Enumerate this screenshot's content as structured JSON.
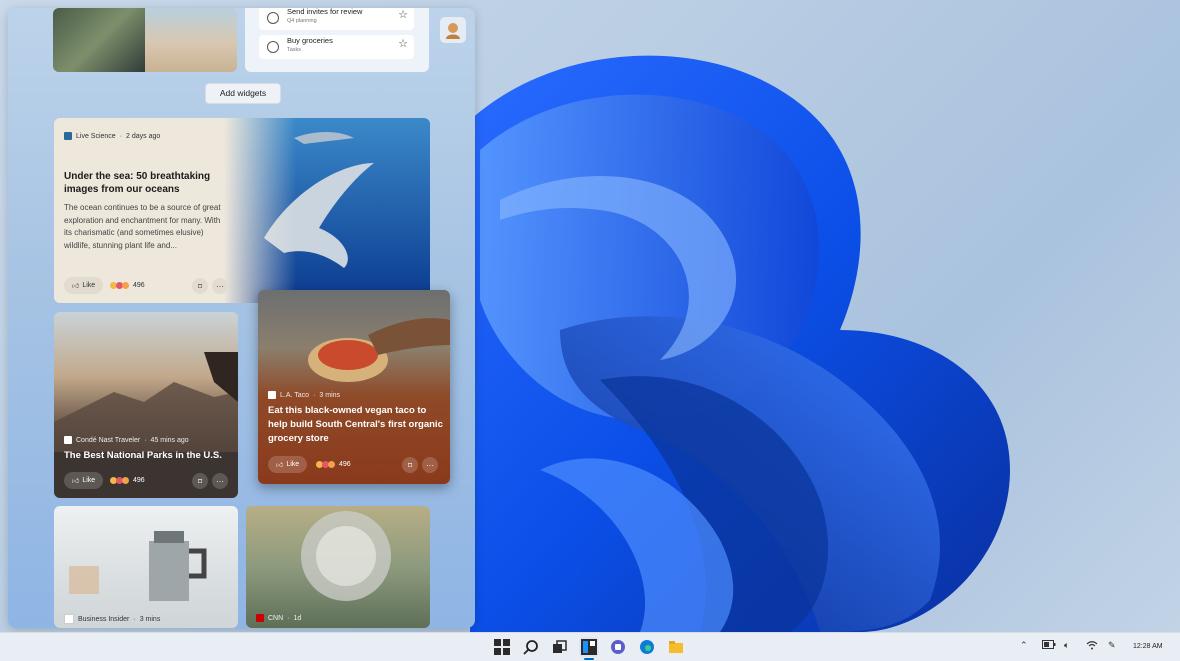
{
  "todo": {
    "items": [
      {
        "title": "Send invites for review",
        "subtitle": "Q4 planning"
      },
      {
        "title": "Buy groceries",
        "subtitle": "Tasks"
      }
    ]
  },
  "panel": {
    "add_widgets_label": "Add widgets"
  },
  "news": [
    {
      "source": "Live Science",
      "time": "2 days ago",
      "title": "Under the sea: 50 breathtaking images from our oceans",
      "summary": "The ocean continues to be a source of great exploration and enchantment for many. With its charismatic (and sometimes elusive) wildlife, stunning plant life and...",
      "like_label": "Like",
      "reactions": "496"
    },
    {
      "source": "Condé Nast Traveler",
      "time": "45 mins ago",
      "title": "The Best National Parks in the U.S.",
      "like_label": "Like",
      "reactions": "496"
    },
    {
      "source": "L.A. Taco",
      "time": "3 mins",
      "title": "Eat this black-owned vegan taco to help build South Central's first organic grocery store",
      "like_label": "Like",
      "reactions": "496"
    },
    {
      "source": "Business Insider",
      "time": "3 mins"
    },
    {
      "source": "CNN",
      "time": "1d"
    }
  ],
  "separator": "·",
  "taskbar": {
    "apps": [
      "start-icon",
      "search-icon",
      "task-view-icon",
      "widgets-icon",
      "chat-icon",
      "edge-icon",
      "file-explorer-icon"
    ],
    "time": "12:28 AM"
  },
  "colors": {
    "accent": "#0067c0",
    "taco_card": "#8a3a1c",
    "parks_card": "#3b3430",
    "ocean_card": "#eee7dc"
  }
}
